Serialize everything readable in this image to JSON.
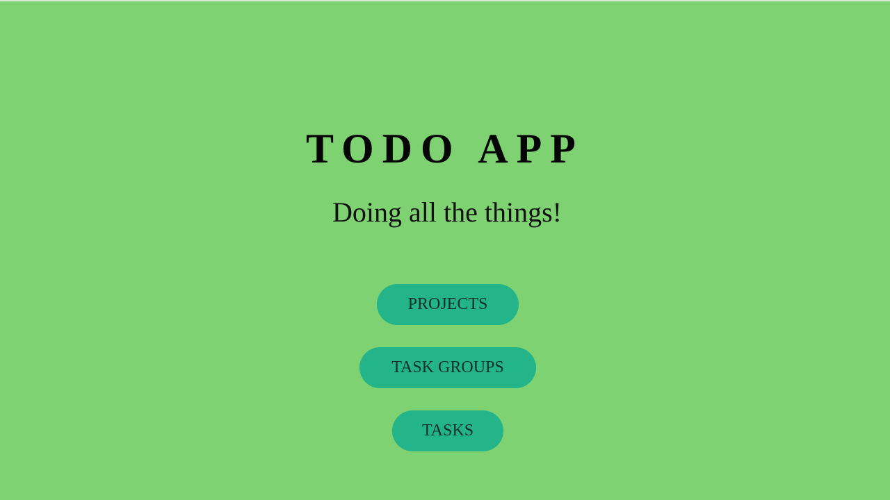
{
  "header": {
    "title": "TODO APP",
    "subtitle": "Doing all the things!"
  },
  "nav": {
    "buttons": [
      {
        "label": "PROJECTS"
      },
      {
        "label": "TASK GROUPS"
      },
      {
        "label": "TASKS"
      }
    ]
  },
  "colors": {
    "background": "#7ed271",
    "button": "#23b48a",
    "text": "#111111"
  }
}
